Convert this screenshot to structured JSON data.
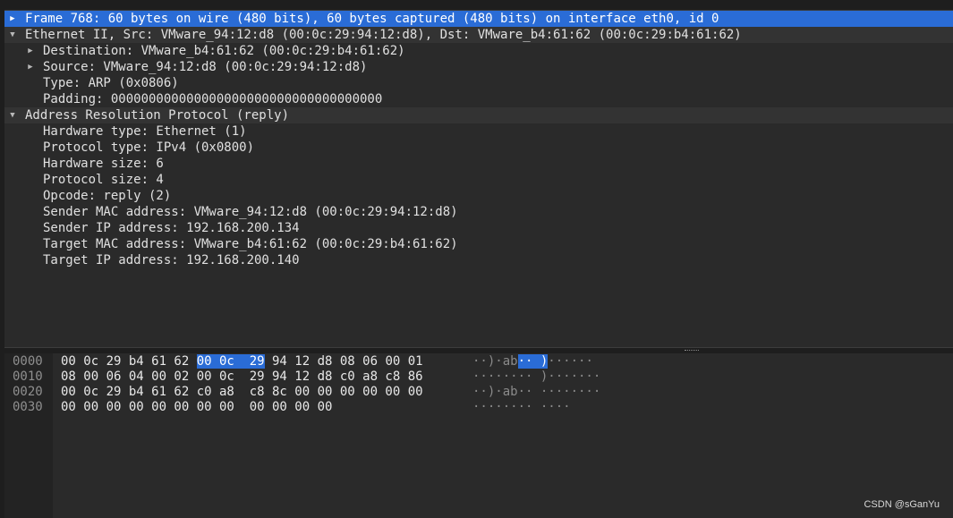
{
  "details": {
    "rows": [
      {
        "text": "Frame 768: 60 bytes on wire (480 bits), 60 bytes captured (480 bits) on interface eth0, id 0",
        "indent": 0,
        "arrow": "collapsed",
        "selected": true,
        "section": false
      },
      {
        "text": "Ethernet II, Src: VMware_94:12:d8 (00:0c:29:94:12:d8), Dst: VMware_b4:61:62 (00:0c:29:b4:61:62)",
        "indent": 0,
        "arrow": "expanded",
        "selected": false,
        "section": true
      },
      {
        "text": "Destination: VMware_b4:61:62 (00:0c:29:b4:61:62)",
        "indent": 1,
        "arrow": "collapsed",
        "selected": false,
        "section": false
      },
      {
        "text": "Source: VMware_94:12:d8 (00:0c:29:94:12:d8)",
        "indent": 1,
        "arrow": "collapsed",
        "selected": false,
        "section": false
      },
      {
        "text": "Type: ARP (0x0806)",
        "indent": 1,
        "arrow": "none",
        "selected": false,
        "section": false
      },
      {
        "text": "Padding: 000000000000000000000000000000000000",
        "indent": 1,
        "arrow": "none",
        "selected": false,
        "section": false
      },
      {
        "text": "Address Resolution Protocol (reply)",
        "indent": 0,
        "arrow": "expanded",
        "selected": false,
        "section": true
      },
      {
        "text": "Hardware type: Ethernet (1)",
        "indent": 1,
        "arrow": "none",
        "selected": false,
        "section": false
      },
      {
        "text": "Protocol type: IPv4 (0x0800)",
        "indent": 1,
        "arrow": "none",
        "selected": false,
        "section": false
      },
      {
        "text": "Hardware size: 6",
        "indent": 1,
        "arrow": "none",
        "selected": false,
        "section": false
      },
      {
        "text": "Protocol size: 4",
        "indent": 1,
        "arrow": "none",
        "selected": false,
        "section": false
      },
      {
        "text": "Opcode: reply (2)",
        "indent": 1,
        "arrow": "none",
        "selected": false,
        "section": false
      },
      {
        "text": "Sender MAC address: VMware_94:12:d8 (00:0c:29:94:12:d8)",
        "indent": 1,
        "arrow": "none",
        "selected": false,
        "section": false
      },
      {
        "text": "Sender IP address: 192.168.200.134",
        "indent": 1,
        "arrow": "none",
        "selected": false,
        "section": false
      },
      {
        "text": "Target MAC address: VMware_b4:61:62 (00:0c:29:b4:61:62)",
        "indent": 1,
        "arrow": "none",
        "selected": false,
        "section": false
      },
      {
        "text": "Target IP address: 192.168.200.140",
        "indent": 1,
        "arrow": "none",
        "selected": false,
        "section": false
      }
    ]
  },
  "bytes": {
    "rows": [
      {
        "offset": "0000",
        "hex": [
          {
            "t": "00 0c 29 b4 61 62 ",
            "hl": false
          },
          {
            "t": "00 0c  29",
            "hl": true
          },
          {
            "t": " 94 12 d8 08 06 00 01",
            "hl": false
          }
        ],
        "ascii": [
          {
            "t": "··)·ab",
            "hl": false
          },
          {
            "t": "·· )",
            "hl": true
          },
          {
            "t": "······",
            "hl": false
          }
        ]
      },
      {
        "offset": "0010",
        "hex": [
          {
            "t": "08 00 06 04 00 02 00 0c  29 94 12 d8 c0 a8 c8 86",
            "hl": false
          }
        ],
        "ascii": [
          {
            "t": "········ )·······",
            "hl": false
          }
        ]
      },
      {
        "offset": "0020",
        "hex": [
          {
            "t": "00 0c 29 b4 61 62 c0 a8  c8 8c 00 00 00 00 00 00",
            "hl": false
          }
        ],
        "ascii": [
          {
            "t": "··)·ab·· ········",
            "hl": false
          }
        ]
      },
      {
        "offset": "0030",
        "hex": [
          {
            "t": "00 00 00 00 00 00 00 00  00 00 00 00",
            "hl": false
          }
        ],
        "ascii": [
          {
            "t": "········ ····",
            "hl": false
          }
        ]
      }
    ]
  },
  "watermark": "CSDN @sGanYu",
  "colors": {
    "selection": "#2a6cd6",
    "pane_bg": "#2a2a2a",
    "text": "#e0e0e0"
  }
}
